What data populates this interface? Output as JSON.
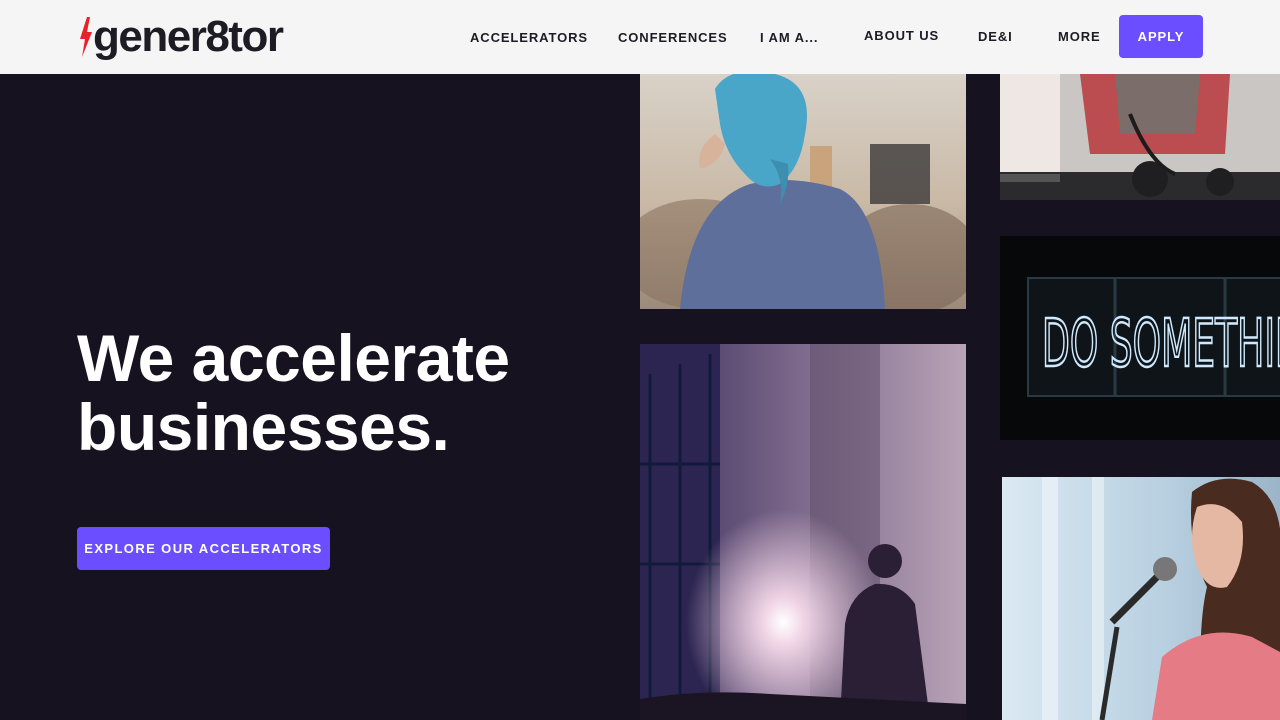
{
  "header": {
    "logo_text": "gener8tor",
    "nav": [
      {
        "label": "Accelerators"
      },
      {
        "label": "Conferences"
      },
      {
        "label": "I am a..."
      },
      {
        "label": "About us"
      },
      {
        "label": "DE&I"
      },
      {
        "label": "More"
      }
    ],
    "apply_label": "Apply"
  },
  "hero": {
    "title_line1": "We accelerate",
    "title_line2": "businesses.",
    "cta_label": "Explore our accelerators"
  },
  "photos": {
    "neon_sign_text": "DO SOMETHIN"
  },
  "colors": {
    "accent": "#6b4eff",
    "background": "#16121f",
    "header_bg": "#f5f5f5",
    "logo_bolt": "#e8222a",
    "nav_text": "#1d1c25"
  }
}
